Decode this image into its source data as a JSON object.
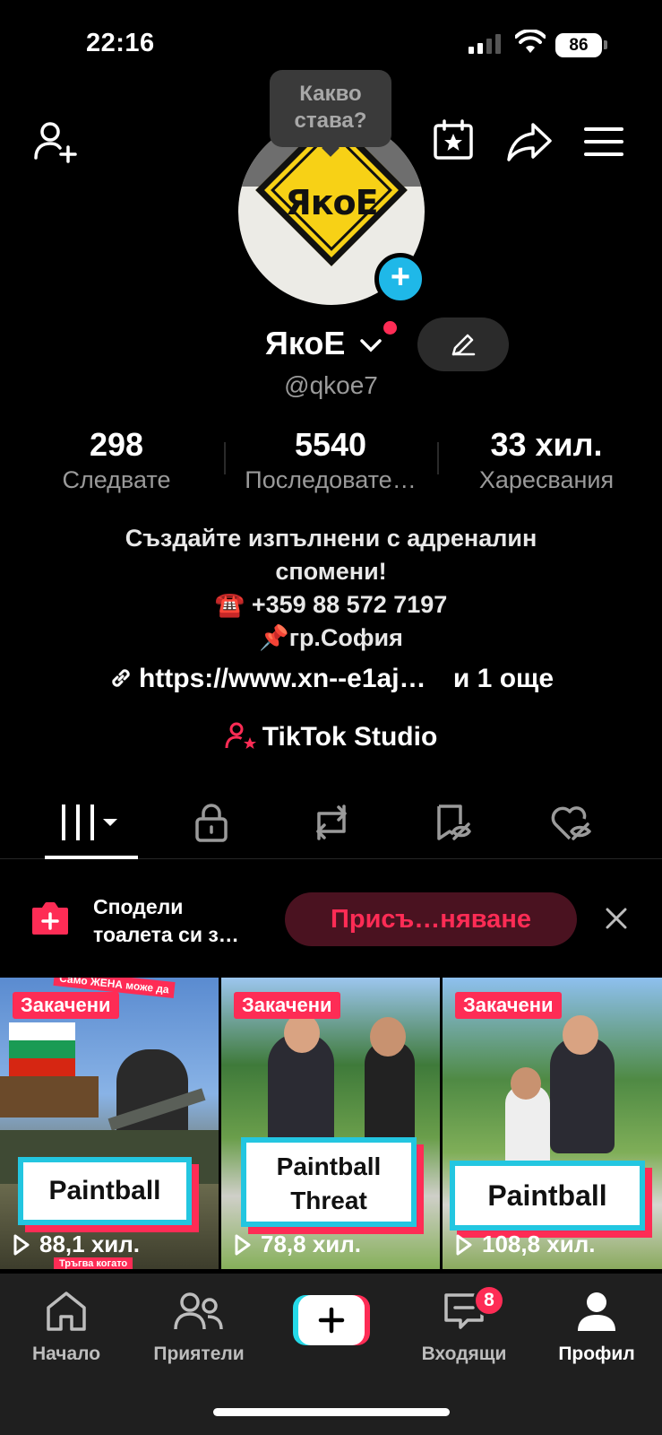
{
  "status_bar": {
    "time": "22:16",
    "battery": "86"
  },
  "profile": {
    "bubble_text": "Какво става?",
    "avatar_text": "ЯкоЕ",
    "name": "ЯкоЕ",
    "handle": "@qkoe7",
    "stats": [
      {
        "value": "298",
        "label": "Следвате"
      },
      {
        "value": "5540",
        "label": "Последовате…"
      },
      {
        "value": "33 хил.",
        "label": "Харесвания"
      }
    ],
    "bio_lines": [
      "Създайте изпълнени с адреналин",
      "спомени!",
      "☎️ +359 88 572 7197",
      "📌гр.София"
    ],
    "link": "https://www.xn--e1aj…",
    "link_more": "и 1 още",
    "studio": "TikTok Studio"
  },
  "promo": {
    "text_line1": "Сподели",
    "text_line2": "тоалета си з…",
    "button": "Присъ…няване"
  },
  "videos": [
    {
      "badge": "Закачени",
      "title": "Paintball",
      "views": "88,1 хил.",
      "overlay_top": "Само ЖЕНА може да",
      "overlay_bottom": "Тръгва когато"
    },
    {
      "badge": "Закачени",
      "title_line1": "Paintball",
      "title_line2": "Threat",
      "views": "78,8 хил."
    },
    {
      "badge": "Закачени",
      "title": "Paintball",
      "views": "108,8 хил."
    }
  ],
  "bottom_nav": {
    "home": "Начало",
    "friends": "Приятели",
    "inbox": "Входящи",
    "inbox_badge": "8",
    "profile": "Профил"
  },
  "colors": {
    "accent": "#fe2c55",
    "cyan": "#1fb8e8"
  }
}
